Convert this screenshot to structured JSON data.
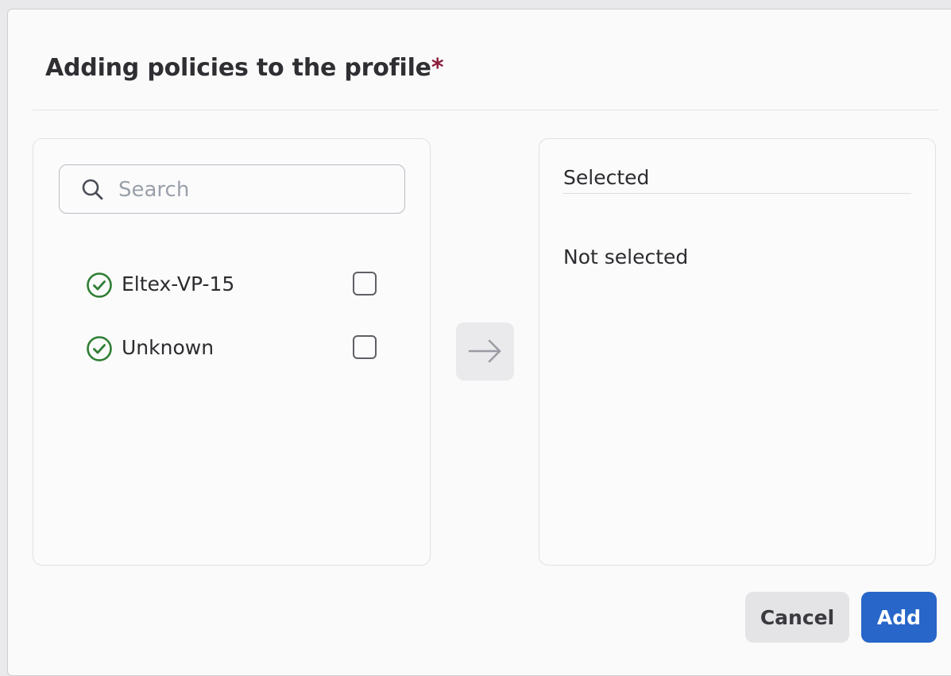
{
  "dialog": {
    "title": "Adding policies to the profile",
    "required_mark": "*",
    "accent_color": "#2866c9",
    "required_color": "#8b1e3a"
  },
  "available": {
    "search_placeholder": "Search",
    "search_value": "",
    "items": [
      {
        "label": "Eltex-VP-15",
        "status_icon": "check-circle-icon",
        "status_color": "#2e7d32",
        "checked": false
      },
      {
        "label": "Unknown",
        "status_icon": "check-circle-icon",
        "status_color": "#2e7d32",
        "checked": false
      }
    ]
  },
  "transfer": {
    "icon": "arrow-right-icon"
  },
  "selected": {
    "header": "Selected",
    "empty_text": "Not selected"
  },
  "footer": {
    "cancel_label": "Cancel",
    "add_label": "Add"
  }
}
